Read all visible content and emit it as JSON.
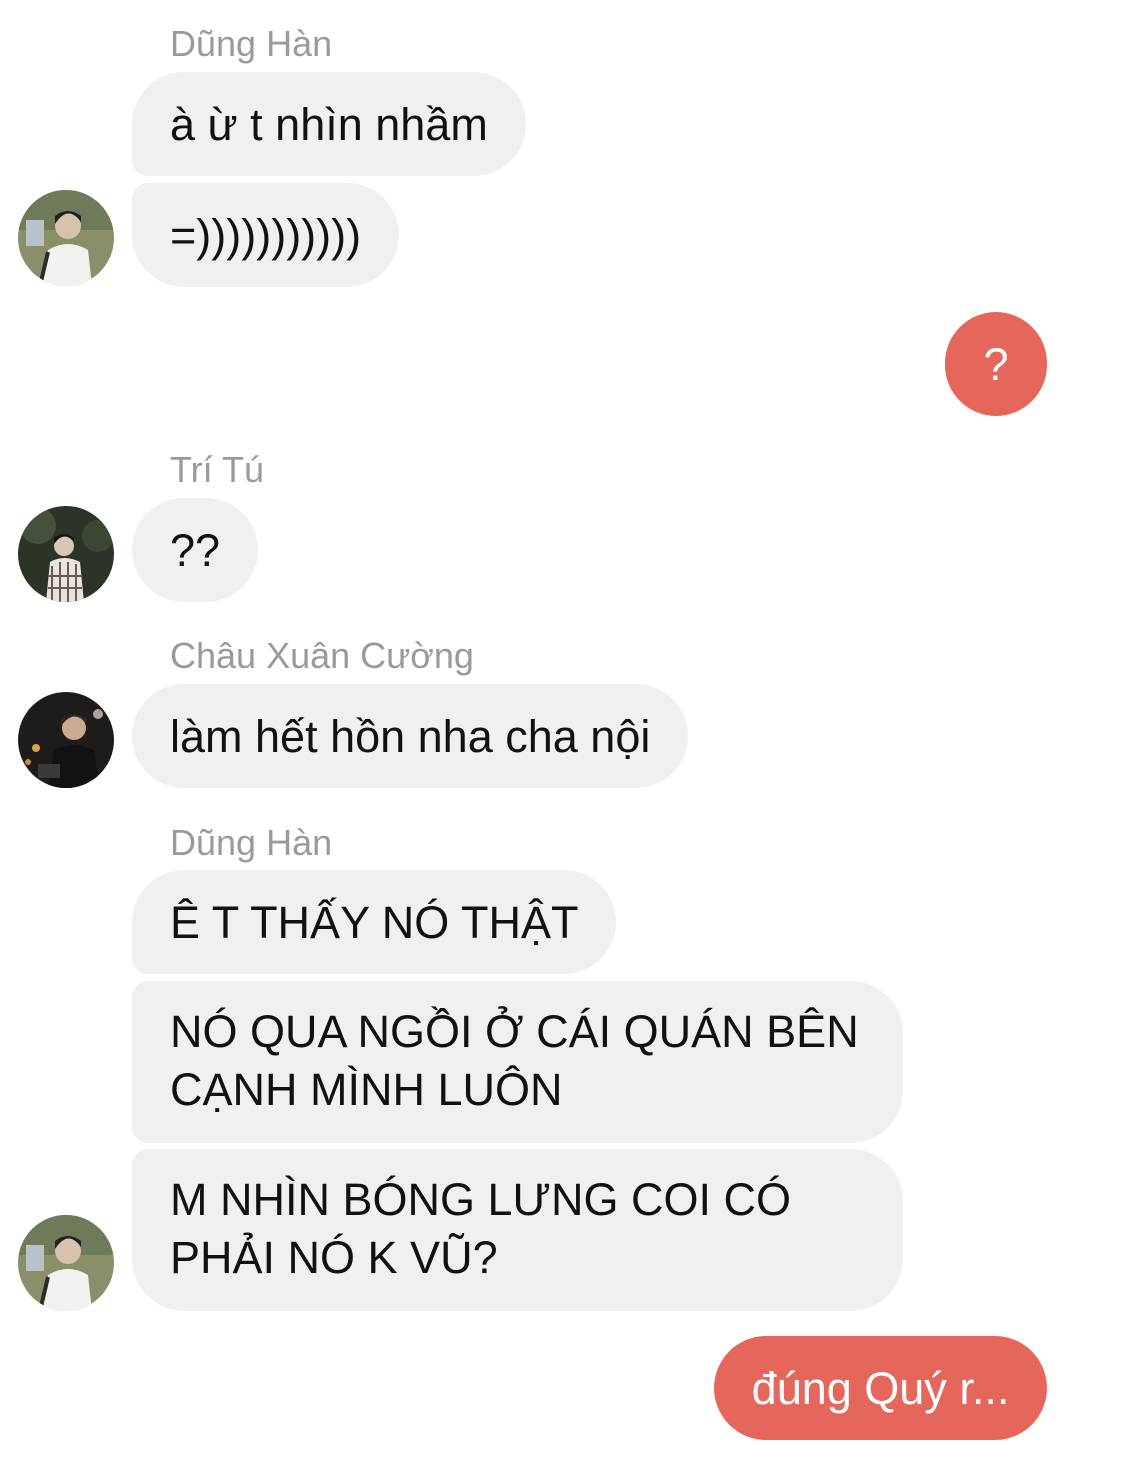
{
  "colors": {
    "incoming_bubble": "#f0f0f0",
    "outgoing_bubble": "#e5675b",
    "sender_name": "#9a9a9a"
  },
  "thread": [
    {
      "sender": "Dũng Hàn",
      "avatar_icon": "user-avatar-dung-han",
      "messages": [
        "à ừ t nhìn nhầm",
        "=)))))))))))"
      ]
    },
    {
      "sender": "me",
      "messages": [
        "?"
      ]
    },
    {
      "sender": "Trí Tú",
      "avatar_icon": "user-avatar-tri-tu",
      "messages": [
        "??"
      ]
    },
    {
      "sender": "Châu Xuân Cường",
      "avatar_icon": "user-avatar-chau-xuan-cuong",
      "messages": [
        "làm hết hồn nha cha nội"
      ]
    },
    {
      "sender": "Dũng Hàn",
      "avatar_icon": "user-avatar-dung-han",
      "messages": [
        "Ê T THẤY NÓ THẬT",
        "NÓ QUA NGỒI Ở CÁI QUÁN BÊN CẠNH MÌNH LUÔN",
        "M NHÌN BÓNG LƯNG COI CÓ PHẢI NÓ K VŨ?"
      ]
    },
    {
      "sender": "me",
      "messages": [
        "đúng Quý r..."
      ]
    }
  ]
}
